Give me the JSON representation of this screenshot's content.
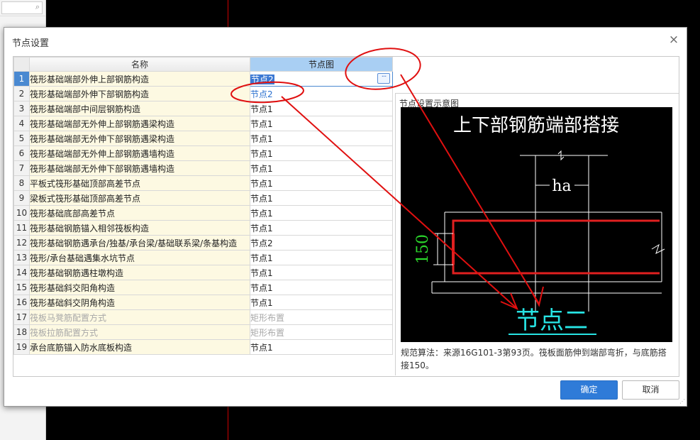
{
  "background": {
    "search_icon": "search-icon"
  },
  "dialog": {
    "title": "节点设置",
    "close_label": "×",
    "headers": {
      "index": "",
      "name": "名称",
      "node": "节点图"
    },
    "rows": [
      {
        "idx": "1",
        "name": "筏形基础端部外伸上部钢筋构造",
        "node": "节点2",
        "state": "editing"
      },
      {
        "idx": "2",
        "name": "筏形基础端部外伸下部钢筋构造",
        "node": "节点2",
        "state": "link"
      },
      {
        "idx": "3",
        "name": "筏形基础端部中间层钢筋构造",
        "node": "节点1",
        "state": "normal"
      },
      {
        "idx": "4",
        "name": "筏形基础端部无外伸上部钢筋遇梁构造",
        "node": "节点1",
        "state": "normal"
      },
      {
        "idx": "5",
        "name": "筏形基础端部无外伸下部钢筋遇梁构造",
        "node": "节点1",
        "state": "normal"
      },
      {
        "idx": "6",
        "name": "筏形基础端部无外伸上部钢筋遇墙构造",
        "node": "节点1",
        "state": "normal"
      },
      {
        "idx": "7",
        "name": "筏形基础端部无外伸下部钢筋遇墙构造",
        "node": "节点1",
        "state": "normal"
      },
      {
        "idx": "8",
        "name": "平板式筏形基础顶部高差节点",
        "node": "节点1",
        "state": "normal"
      },
      {
        "idx": "9",
        "name": "梁板式筏形基础顶部高差节点",
        "node": "节点1",
        "state": "normal"
      },
      {
        "idx": "10",
        "name": "筏形基础底部高差节点",
        "node": "节点1",
        "state": "normal"
      },
      {
        "idx": "11",
        "name": "筏形基础钢筋锚入相邻筏板构造",
        "node": "节点1",
        "state": "normal"
      },
      {
        "idx": "12",
        "name": "筏形基础钢筋遇承台/独基/承台梁/基础联系梁/条基构造",
        "node": "节点2",
        "state": "normal"
      },
      {
        "idx": "13",
        "name": "筏形/承台基础遇集水坑节点",
        "node": "节点1",
        "state": "normal"
      },
      {
        "idx": "14",
        "name": "筏形基础钢筋遇柱墩构造",
        "node": "节点1",
        "state": "normal"
      },
      {
        "idx": "15",
        "name": "筏形基础斜交阳角构造",
        "node": "节点1",
        "state": "normal"
      },
      {
        "idx": "16",
        "name": "筏形基础斜交阴角构造",
        "node": "节点1",
        "state": "normal"
      },
      {
        "idx": "17",
        "name": "筏板马凳筋配置方式",
        "node": "矩形布置",
        "state": "disabled"
      },
      {
        "idx": "18",
        "name": "筏板拉筋配置方式",
        "node": "矩形布置",
        "state": "disabled"
      },
      {
        "idx": "19",
        "name": "承台底筋锚入防水底板构造",
        "node": "节点1",
        "state": "normal"
      }
    ],
    "ellipsis_label": "···",
    "preview_label": "节点设置示意图",
    "diagram": {
      "title": "上下部钢筋端部搭接",
      "dim_ha": "ha",
      "dim_150": "150",
      "node_label": "节点二"
    },
    "note": "规范算法：来源16G101-3第93页。筏板面筋伸到端部弯折，与底筋搭接150。",
    "ok_label": "确定",
    "cancel_label": "取消"
  },
  "colors": {
    "accent": "#2f7bd8",
    "annotation_red": "#e01010",
    "diagram_green": "#2bd62b",
    "diagram_cyan": "#27e3e3",
    "diagram_red": "#e02020"
  }
}
